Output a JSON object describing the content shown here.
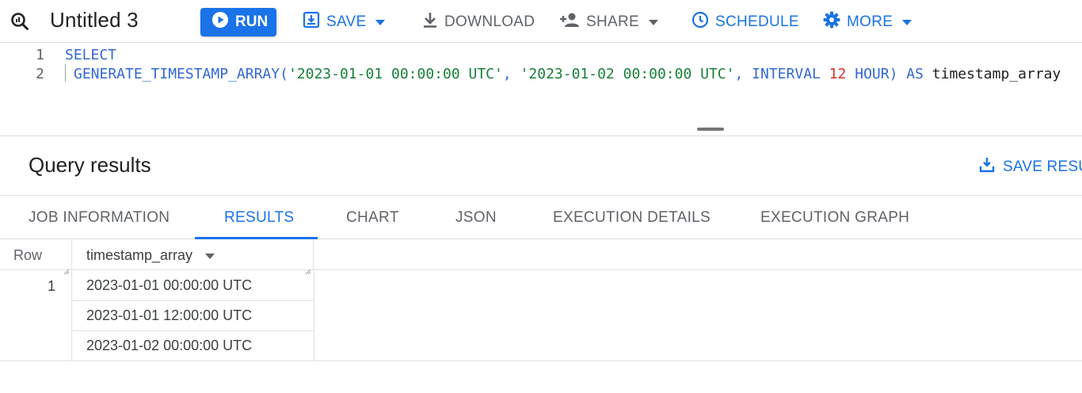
{
  "toolbar": {
    "title": "Untitled 3",
    "run_label": "RUN",
    "save_label": "SAVE",
    "download_label": "DOWNLOAD",
    "share_label": "SHARE",
    "schedule_label": "SCHEDULE",
    "more_label": "MORE",
    "logo_icon": "bigquery-query-icon"
  },
  "editor": {
    "lines": [
      {
        "number": "1",
        "tokens": [
          {
            "text": "SELECT",
            "kind": "kw"
          }
        ]
      },
      {
        "number": "2",
        "tokens": [
          {
            "text": "GENERATE_TIMESTAMP_ARRAY(",
            "kind": "kw"
          },
          {
            "text": "'2023-01-01 00:00:00 UTC'",
            "kind": "str"
          },
          {
            "text": ", ",
            "kind": "kw"
          },
          {
            "text": "'2023-01-02 00:00:00 UTC'",
            "kind": "str"
          },
          {
            "text": ", INTERVAL ",
            "kind": "kw"
          },
          {
            "text": "12",
            "kind": "num"
          },
          {
            "text": " HOUR) AS ",
            "kind": "kw"
          },
          {
            "text": "timestamp_array",
            "kind": "ident"
          }
        ]
      }
    ]
  },
  "results": {
    "title": "Query results",
    "save_results_label": "SAVE RESU",
    "tabs": [
      {
        "label": "JOB INFORMATION",
        "active": false
      },
      {
        "label": "RESULTS",
        "active": true
      },
      {
        "label": "CHART",
        "active": false
      },
      {
        "label": "JSON",
        "active": false
      },
      {
        "label": "EXECUTION DETAILS",
        "active": false
      },
      {
        "label": "EXECUTION GRAPH",
        "active": false
      }
    ],
    "table": {
      "row_header": "Row",
      "column_header": "timestamp_array",
      "rows": [
        {
          "row": "1",
          "values": [
            "2023-01-01 00:00:00 UTC",
            "2023-01-01 12:00:00 UTC",
            "2023-01-02 00:00:00 UTC"
          ]
        }
      ]
    }
  },
  "colors": {
    "accent": "#1a73e8",
    "keyword": "#3367d6",
    "string": "#188038",
    "number": "#d93025"
  }
}
